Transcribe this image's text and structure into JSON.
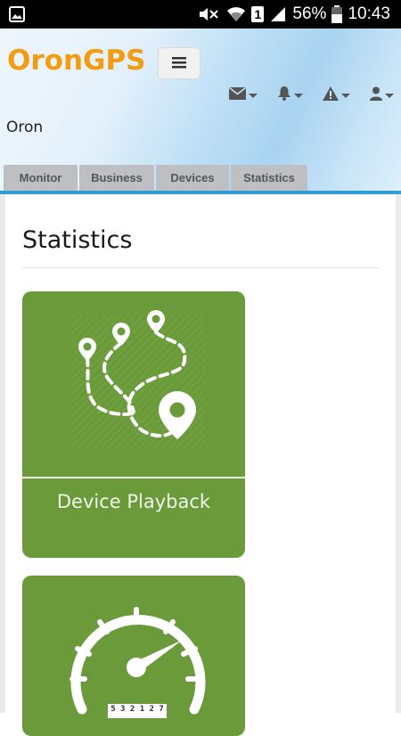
{
  "status_bar": {
    "battery_percent": "56%",
    "time": "10:43",
    "sim_label": "1"
  },
  "header": {
    "brand": "OronGPS",
    "user_name": "Oron",
    "icons": [
      "envelope-icon",
      "bell-icon",
      "warning-icon",
      "user-icon"
    ]
  },
  "tabs": [
    {
      "label": "Monitor"
    },
    {
      "label": "Business"
    },
    {
      "label": "Devices"
    },
    {
      "label": "Statistics"
    }
  ],
  "main": {
    "title": "Statistics",
    "cards": [
      {
        "label": "Device Playback",
        "icon": "route-map-pins-icon"
      },
      {
        "label": "",
        "icon": "speedometer-icon",
        "odometer": "5 3 2 1 2 7"
      }
    ]
  },
  "colors": {
    "brand": "#f39c12",
    "card_green": "#6a9a3a",
    "accent_blue": "#2f9cd7"
  }
}
